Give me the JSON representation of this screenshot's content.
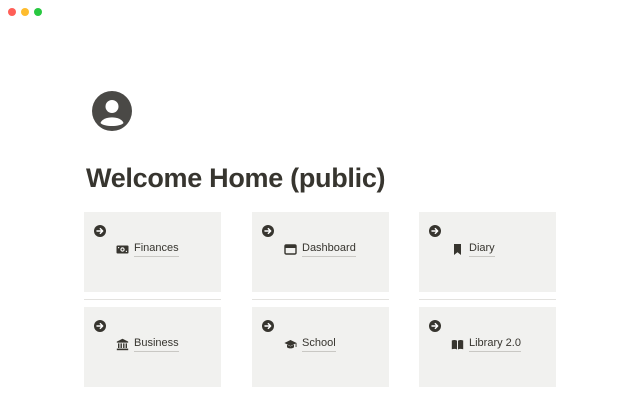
{
  "window": {
    "controls": [
      "close",
      "minimize",
      "zoom"
    ]
  },
  "page": {
    "icon": "user-avatar-icon",
    "title": "Welcome Home (public)"
  },
  "cards": [
    {
      "label": "Finances",
      "icon": "money-icon"
    },
    {
      "label": "Dashboard",
      "icon": "browser-window-icon"
    },
    {
      "label": "Diary",
      "icon": "bookmark-icon"
    },
    {
      "label": "Business",
      "icon": "bank-icon"
    },
    {
      "label": "School",
      "icon": "graduation-cap-icon"
    },
    {
      "label": "Library 2.0",
      "icon": "open-book-icon"
    }
  ],
  "colors": {
    "card_background": "#f1f1ef",
    "text": "#37352f"
  }
}
